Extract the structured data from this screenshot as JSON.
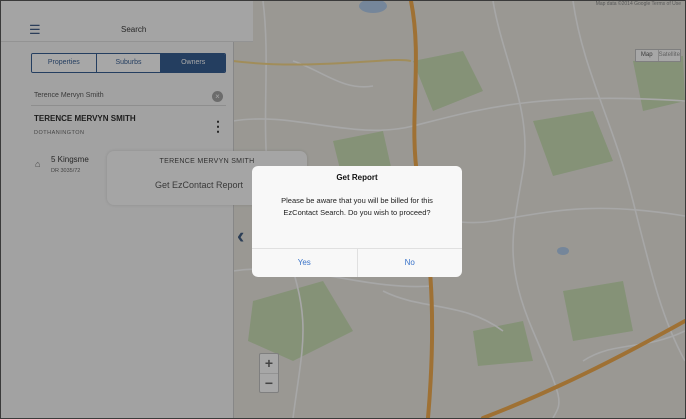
{
  "header": {
    "menu_icon": "hamburger-icon",
    "title": "Search"
  },
  "tabs": [
    {
      "label": "Properties",
      "active": false
    },
    {
      "label": "Suburbs",
      "active": false
    },
    {
      "label": "Owners",
      "active": true
    }
  ],
  "search": {
    "value": "Terence Mervyn Smith",
    "clear_icon": "clear-circle-icon"
  },
  "result": {
    "name": "TERENCE MERVYN SMITH",
    "subtitle": "DOTHANINGTON",
    "more_icon": "more-vertical-icon",
    "property_icon": "house-icon",
    "property_address": "5 Kingsme",
    "property_subtitle": "DR 3035/72"
  },
  "popover": {
    "title": "TERENCE MERVYN SMITH",
    "action": "Get EzContact Report"
  },
  "dialog": {
    "title": "Get Report",
    "message": "Please be aware that you will be billed for this EzContact Search. Do you wish to proceed?",
    "yes": "Yes",
    "no": "No"
  },
  "map": {
    "attribution": "Map data ©2014 Google   Terms of Use",
    "type_options": [
      "Map",
      "Satellite"
    ],
    "zoom_in": "+",
    "zoom_out": "−",
    "collapse_icon": "chevron-left-icon",
    "colors": {
      "base": "#e8e6dd",
      "park": "#c4dbad",
      "water": "#a9c7e8",
      "highway": "#f1a33a",
      "road": "#ffffff"
    }
  },
  "overlay": {
    "color": "rgba(45,45,45,0.42)"
  }
}
